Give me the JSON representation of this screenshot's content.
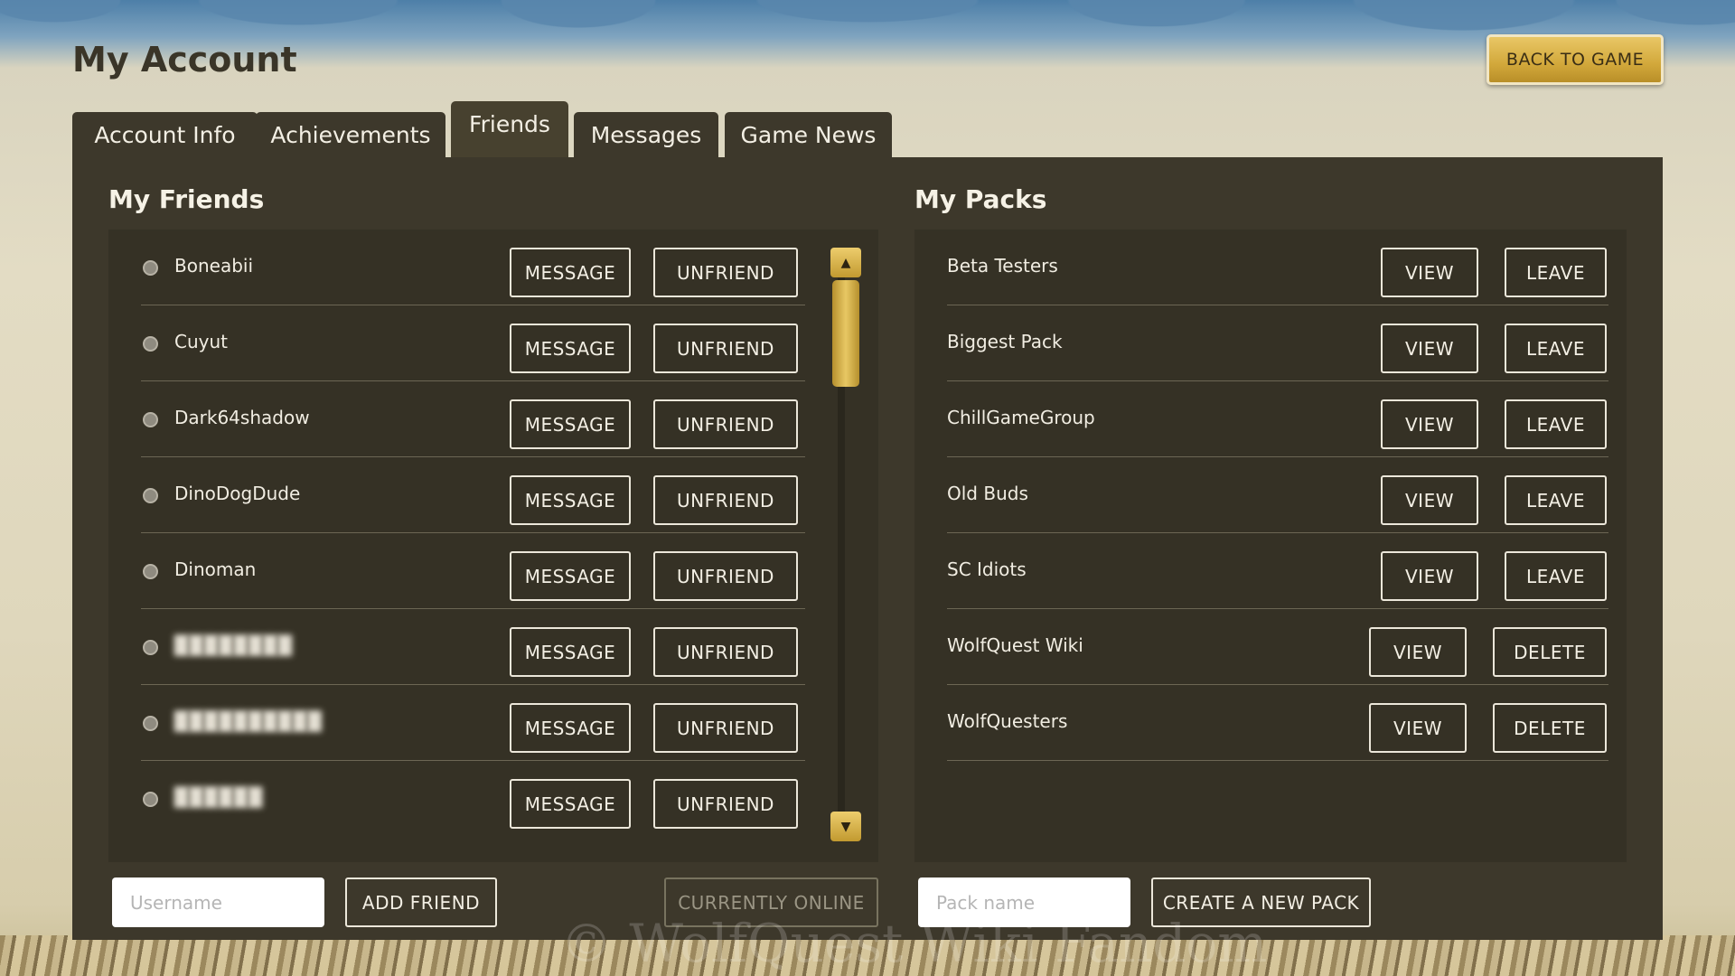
{
  "header": {
    "title": "My Account",
    "back_label": "BACK TO GAME"
  },
  "tabs": [
    {
      "label": "Account Info"
    },
    {
      "label": "Achievements"
    },
    {
      "label": "Friends",
      "active": true
    },
    {
      "label": "Messages"
    },
    {
      "label": "Game News"
    }
  ],
  "friends": {
    "title": "My Friends",
    "message_label": "MESSAGE",
    "unfriend_label": "UNFRIEND",
    "items": [
      {
        "name": "Boneabii"
      },
      {
        "name": "Cuyut"
      },
      {
        "name": "Dark64shadow"
      },
      {
        "name": "DinoDogDude"
      },
      {
        "name": "Dinoman"
      },
      {
        "name": "████████",
        "blurred": true
      },
      {
        "name": "██████████",
        "blurred": true
      },
      {
        "name": "██████",
        "blurred": true
      }
    ],
    "username_placeholder": "Username",
    "add_label": "ADD FRIEND",
    "online_label": "CURRENTLY ONLINE",
    "scroll_up": "▲",
    "scroll_down": "▼"
  },
  "packs": {
    "title": "My Packs",
    "view_label": "VIEW",
    "items": [
      {
        "name": "Beta Testers",
        "action": "LEAVE"
      },
      {
        "name": "Biggest Pack",
        "action": "LEAVE"
      },
      {
        "name": "ChillGameGroup",
        "action": "LEAVE"
      },
      {
        "name": "Old Buds",
        "action": "LEAVE"
      },
      {
        "name": "SC Idiots",
        "action": "LEAVE"
      },
      {
        "name": "WolfQuest Wiki",
        "action": "DELETE"
      },
      {
        "name": "WolfQuesters",
        "action": "DELETE"
      }
    ],
    "packname_placeholder": "Pack name",
    "create_label": "CREATE A NEW PACK"
  },
  "watermark": "© WolfQuest Wiki Fandom",
  "colors": {
    "panel": "#3d382b",
    "accent_gold": "#d2a83b",
    "text": "#f3efe4"
  }
}
